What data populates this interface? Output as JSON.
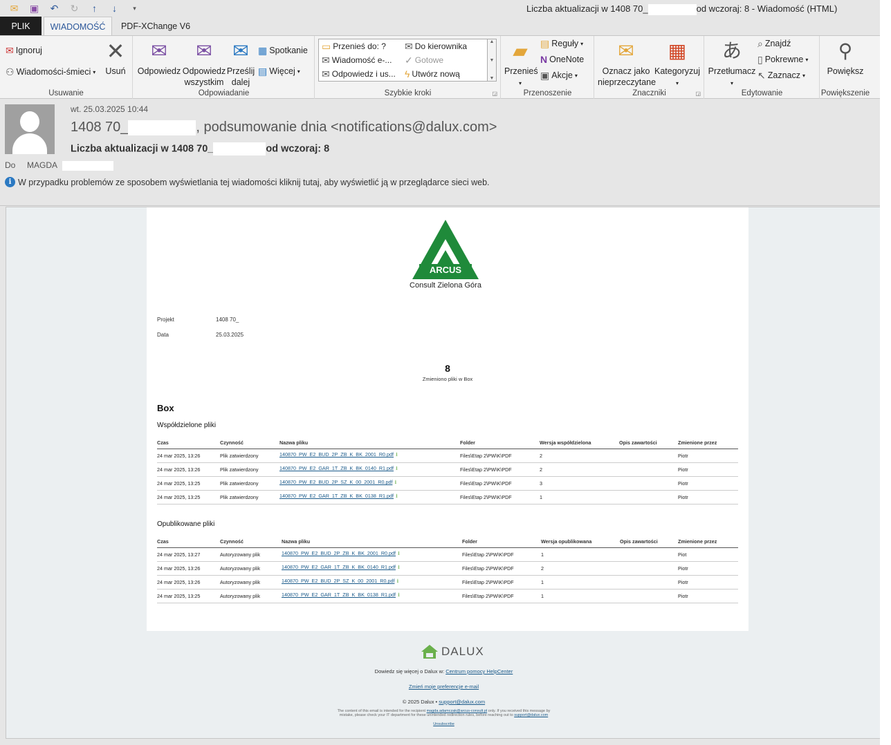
{
  "window": {
    "title_prefix": "Liczba aktualizacji w 1408 70_",
    "title_suffix": "od wczoraj: 8 - Wiadomość (HTML)"
  },
  "tabs": [
    "PLIK",
    "WIADOMOŚĆ",
    "PDF-XChange V6"
  ],
  "ribbon": {
    "delete_group": {
      "label": "Usuwanie",
      "ignore": "Ignoruj",
      "junk": "Wiadomości-śmieci",
      "delete": "Usuń"
    },
    "respond_group": {
      "label": "Odpowiadanie",
      "reply": "Odpowiedz",
      "reply_all_1": "Odpowiedz",
      "reply_all_2": "wszystkim",
      "forward_1": "Prześlij",
      "forward_2": "dalej",
      "meeting": "Spotkanie",
      "more": "Więcej"
    },
    "quicksteps_group": {
      "label": "Szybkie kroki",
      "items": [
        "Przenieś do: ?",
        "Do kierownika",
        "Wiadomość e-...",
        "Gotowe",
        "Odpowiedz i us...",
        "Utwórz nową"
      ]
    },
    "move_group": {
      "label": "Przenoszenie",
      "move": "Przenieś",
      "rules": "Reguły",
      "onenote": "OneNote",
      "actions": "Akcje"
    },
    "tags_group": {
      "label": "Znaczniki",
      "mark_unread_1": "Oznacz jako",
      "mark_unread_2": "nieprzeczytane",
      "categorize": "Kategoryzuj"
    },
    "editing_group": {
      "label": "Edytowanie",
      "translate": "Przetłumacz",
      "find": "Znajdź",
      "related": "Pokrewne",
      "select": "Zaznacz"
    },
    "zoom_group": {
      "label": "Powiększenie",
      "zoom": "Powiększ"
    }
  },
  "header": {
    "date": "wt. 25.03.2025 10:44",
    "from_prefix": "1408 70_",
    "from_suffix": ", podsumowanie dnia <notifications@dalux.com>",
    "subject_prefix": "Liczba aktualizacji w 1408 70_",
    "subject_suffix": "od wczoraj: 8",
    "to_label": "Do",
    "to_name": "MAGDA",
    "info": "W przypadku problemów ze sposobem wyświetlania tej wiadomości kliknij tutaj, aby wyświetlić ją w przeglądarce sieci web."
  },
  "email": {
    "logo_text": "ARCUS",
    "logo_sub": "Consult Zielona Góra",
    "project_label": "Projekt",
    "project_value": "1408 70_",
    "date_label": "Data",
    "date_value": "25.03.2025",
    "count": "8",
    "count_label": "Zmieniono pliki w Box",
    "section": "Box",
    "shared": {
      "title": "Współdzielone pliki",
      "headers": [
        "Czas",
        "Czynność",
        "Nazwa pliku",
        "Folder",
        "Wersja współdzielona",
        "Opis zawartości",
        "Zmienione przez"
      ],
      "rows": [
        [
          "24 mar 2025, 13:26",
          "Plik zatwierdzony",
          "140870_PW_E2_BUD_2P_ZB_K_BK_2001_R0.pdf",
          "Files\\Etap 2\\PW\\K\\PDF",
          "2",
          "",
          "Piotr"
        ],
        [
          "24 mar 2025, 13:26",
          "Plik zatwierdzony",
          "140870_PW_E2_GAR_1T_ZB_K_BK_0140_R1.pdf",
          "Files\\Etap 2\\PW\\K\\PDF",
          "2",
          "",
          "Piotr"
        ],
        [
          "24 mar 2025, 13:25",
          "Plik zatwierdzony",
          "140870_PW_E2_BUD_2P_SZ_K_00_2001_R0.pdf",
          "Files\\Etap 2\\PW\\K\\PDF",
          "3",
          "",
          "Piotr"
        ],
        [
          "24 mar 2025, 13:25",
          "Plik zatwierdzony",
          "140870_PW_E2_GAR_1T_ZB_K_BK_0138_R1.pdf",
          "Files\\Etap 2\\PW\\K\\PDF",
          "1",
          "",
          "Piotr"
        ]
      ]
    },
    "published": {
      "title": "Opublikowane pliki",
      "headers": [
        "Czas",
        "Czynność",
        "Nazwa pliku",
        "Folder",
        "Wersja opublikowana",
        "Opis zawartości",
        "Zmienione przez"
      ],
      "rows": [
        [
          "24 mar 2025, 13:27",
          "Autoryzowany plik",
          "140870_PW_E2_BUD_2P_ZB_K_BK_2001_R0.pdf",
          "Files\\Etap 2\\PW\\K\\PDF",
          "1",
          "",
          "Piot"
        ],
        [
          "24 mar 2025, 13:26",
          "Autoryzowany plik",
          "140870_PW_E2_GAR_1T_ZB_K_BK_0140_R1.pdf",
          "Files\\Etap 2\\PW\\K\\PDF",
          "2",
          "",
          "Piotr"
        ],
        [
          "24 mar 2025, 13:26",
          "Autoryzowany plik",
          "140870_PW_E2_BUD_2P_SZ_K_00_2001_R0.pdf",
          "Files\\Etap 2\\PW\\K\\PDF",
          "1",
          "",
          "Piotr"
        ],
        [
          "24 mar 2025, 13:25",
          "Autoryzowany plik",
          "140870_PW_E2_GAR_1T_ZB_K_BK_0138_R1.pdf",
          "Files\\Etap 2\\PW\\K\\PDF",
          "1",
          "",
          "Piotr"
        ]
      ]
    }
  },
  "footer": {
    "brand": "DALUX",
    "learn_prefix": "Dowiedz się więcej o Dalux w: ",
    "learn_link": "Centrum pomocy HelpCenter",
    "prefs": "Zmień moje preferencje e-mail",
    "copyright": "© 2025 Dalux • ",
    "support": "support@dalux.com",
    "disclaimer_1": "The content of this email is intended for the recipient ",
    "disclaimer_email": "magda.adamczak@arcus-consult.pl",
    "disclaimer_2": " only. If you received this message by",
    "disclaimer_3": "mistake, please check your IT department for these unintended redirection rules, before reaching out to ",
    "disclaimer_support": "support@dalux.com",
    "unsubscribe": "Unsubscribe"
  },
  "colors": {
    "accent": "#2b579a",
    "arcus_green": "#1f8a3a",
    "dalux_green": "#6ab04c"
  }
}
